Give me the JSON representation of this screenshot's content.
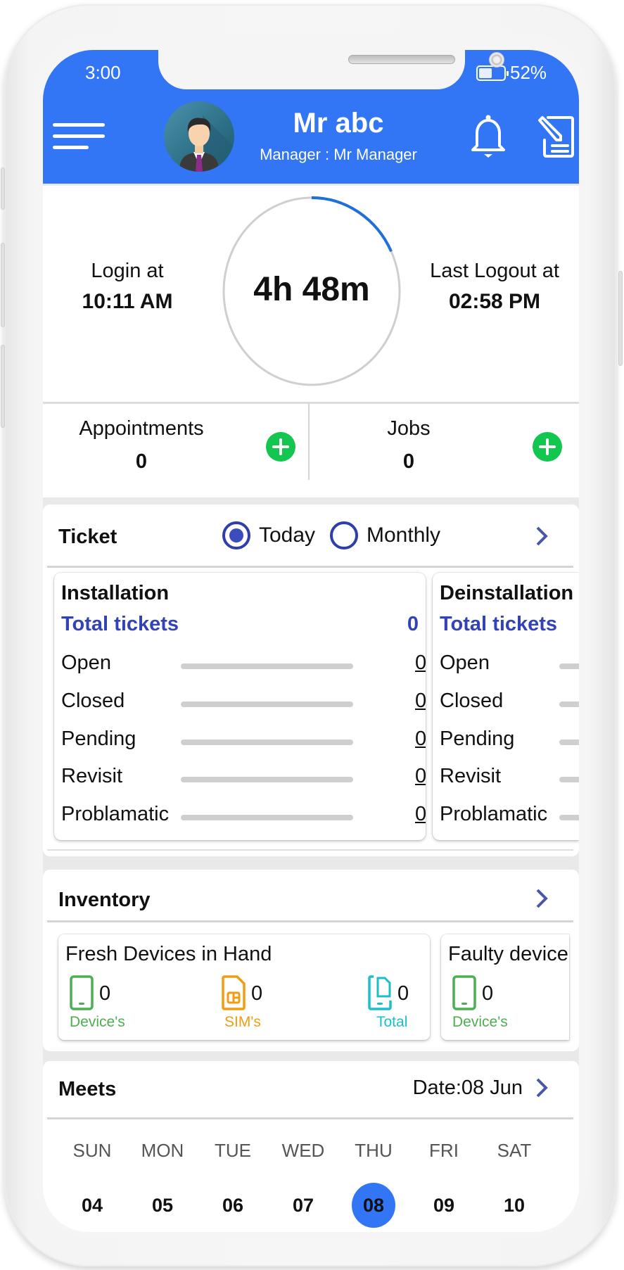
{
  "status_bar": {
    "time": "3:00",
    "battery": "52%"
  },
  "header": {
    "user_name": "Mr abc",
    "subtitle": "Manager : Mr Manager",
    "colors": {
      "primary": "#3275f5"
    }
  },
  "timer": {
    "login_label": "Login at",
    "login_time": "10:11 AM",
    "duration": "4h 48m",
    "progress_fraction": 0.18,
    "logout_label": "Last Logout at",
    "logout_time": "02:58 PM"
  },
  "counters": [
    {
      "label": "Appointments",
      "value": "0"
    },
    {
      "label": "Jobs",
      "value": "0"
    }
  ],
  "ticket": {
    "title": "Ticket",
    "filters": [
      {
        "label": "Today",
        "selected": true
      },
      {
        "label": "Monthly",
        "selected": false
      }
    ],
    "groups": [
      {
        "title": "Installation",
        "total_label": "Total tickets",
        "total_value": "0",
        "rows": [
          {
            "label": "Open",
            "value": "0"
          },
          {
            "label": "Closed",
            "value": "0"
          },
          {
            "label": "Pending",
            "value": "0"
          },
          {
            "label": "Revisit",
            "value": "0"
          },
          {
            "label": "Problamatic",
            "value": "0"
          }
        ]
      },
      {
        "title": "Deinstallation",
        "total_label": "Total tickets",
        "rows": [
          {
            "label": "Open"
          },
          {
            "label": "Closed"
          },
          {
            "label": "Pending"
          },
          {
            "label": "Revisit"
          },
          {
            "label": "Problamatic"
          }
        ]
      }
    ]
  },
  "inventory": {
    "title": "Inventory",
    "groups": [
      {
        "title": "Fresh Devices in Hand",
        "items": [
          {
            "icon": "phone-icon",
            "count": "0",
            "caption": "Device's",
            "color": "#4caf50"
          },
          {
            "icon": "sim-card-icon",
            "count": "0",
            "caption": "SIM's",
            "color": "#f39c12"
          },
          {
            "icon": "phone-sim-icon",
            "count": "0",
            "caption": "Total",
            "color": "#1bbfcb"
          }
        ]
      },
      {
        "title": "Faulty device",
        "items": [
          {
            "icon": "phone-icon",
            "count": "0",
            "caption": "Device's",
            "color": "#4caf50"
          }
        ]
      }
    ]
  },
  "meets": {
    "title": "Meets",
    "date": "Date:08 Jun",
    "days": [
      {
        "weekday": "SUN",
        "date": "04"
      },
      {
        "weekday": "MON",
        "date": "05"
      },
      {
        "weekday": "TUE",
        "date": "06"
      },
      {
        "weekday": "WED",
        "date": "07"
      },
      {
        "weekday": "THU",
        "date": "08",
        "selected": true
      },
      {
        "weekday": "FRI",
        "date": "09"
      },
      {
        "weekday": "SAT",
        "date": "10"
      }
    ]
  }
}
